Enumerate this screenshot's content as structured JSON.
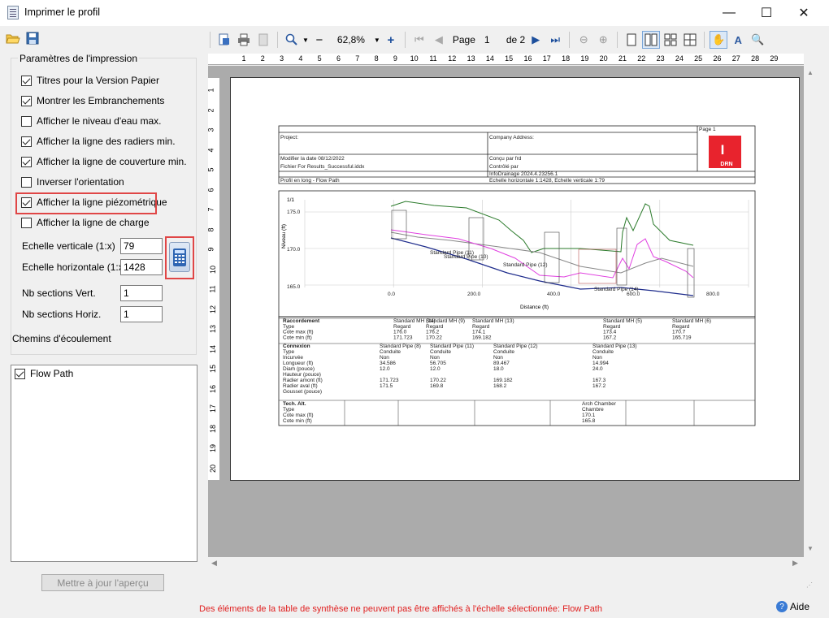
{
  "window": {
    "title": "Imprimer le profil",
    "minimize": "—",
    "maximize": "☐",
    "close": "✕"
  },
  "left_toolbar": {
    "open_icon": "folder-open-icon",
    "save_icon": "save-icon"
  },
  "print_settings": {
    "group_title": "Paramètres de l'impression",
    "options": [
      {
        "label": "Titres pour la Version Papier",
        "checked": true
      },
      {
        "label": "Montrer les Embranchements",
        "checked": true
      },
      {
        "label": "Afficher le niveau d'eau max.",
        "checked": false
      },
      {
        "label": "Afficher la ligne des radiers min.",
        "checked": true
      },
      {
        "label": "Afficher la ligne de couverture min.",
        "checked": true
      },
      {
        "label": "Inverser l'orientation",
        "checked": false
      },
      {
        "label": "Afficher la ligne piézométrique",
        "checked": true
      },
      {
        "label": "Afficher la ligne de charge",
        "checked": false
      }
    ],
    "vertical_scale_label": "Echelle verticale (1:x)",
    "vertical_scale_value": "79",
    "horizontal_scale_label": "Echelle horizontale (1:x)",
    "horizontal_scale_value": "1428",
    "vert_sections_label": "Nb sections Vert.",
    "vert_sections_value": "1",
    "horiz_sections_label": "Nb sections Horiz.",
    "horiz_sections_value": "1",
    "flow_paths_label": "Chemins d'écoulement"
  },
  "flow_paths": [
    {
      "label": "Flow Path",
      "checked": true
    }
  ],
  "update_button": "Mettre à jour l'aperçu",
  "preview_toolbar": {
    "zoom_value": "62,8%",
    "page_label": "Page",
    "page_current": "1",
    "page_of": "de 2",
    "minus": "−",
    "plus": "+"
  },
  "ruler_h": [
    "1",
    "2",
    "3",
    "4",
    "5",
    "6",
    "7",
    "8",
    "9",
    "10",
    "11",
    "12",
    "13",
    "14",
    "15",
    "16",
    "17",
    "18",
    "19",
    "20",
    "21",
    "22",
    "23",
    "24",
    "25",
    "26",
    "27",
    "28",
    "29"
  ],
  "ruler_v": [
    "1",
    "2",
    "3",
    "4",
    "5",
    "6",
    "7",
    "8",
    "9",
    "10",
    "11",
    "12",
    "13",
    "14",
    "15",
    "16",
    "17",
    "18",
    "19",
    "20"
  ],
  "report": {
    "project_label": "Project:",
    "company_label": "Company Address:",
    "page_label": "Page 1",
    "modified": "Modifier la date 08/12/2022",
    "file": "Fichier For Results_Successful.iddx",
    "designed": "Conçu par frd",
    "checked": "Contrôlé par",
    "version": "InfoDrainage 2024.4.23256.1",
    "profile": "Profil en long - Flow Path",
    "scales": "Echelle horizontale 1:1428, Echelle verticale 1:79",
    "logo_letter": "I",
    "logo_text": "DRN",
    "chart_scale": "1/1",
    "y_axis": "Niveau (ft)",
    "x_axis": "Distance (ft)",
    "y_ticks": [
      "175.0",
      "170.0",
      "165.0"
    ],
    "x_ticks": [
      "0.0",
      "200.0",
      "400.0",
      "600.0",
      "800.0"
    ],
    "pipe_labels": [
      "Standard Pipe (11)",
      "Standard Pipe (10)",
      "Standard Pipe (12)",
      "Standard Pipe (14)"
    ],
    "table_rows_a": [
      "Raccordement",
      "Type",
      "Cote max (ft)",
      "Cote min (ft)"
    ],
    "table_a": [
      [
        "Standard MH (14)",
        "Regard",
        "176.0",
        "171.723"
      ],
      [
        "Standard MH (9)",
        "Regard",
        "176.2",
        "170.22"
      ],
      [
        "Standard MH (13)",
        "Regard",
        "174.1",
        "169.182"
      ],
      [
        "Standard MH (5)",
        "Regard",
        "173.4",
        "167.2"
      ],
      [
        "Standard MH (6)",
        "Regard",
        "170.7",
        "165.719"
      ]
    ],
    "table_rows_b": [
      "Connexion",
      "Type",
      "Incurvée",
      "Longueur (ft)",
      "Diam (pouce)",
      "Hauteur (pouce)",
      "Radier amont (ft)",
      "Radier aval (ft)",
      "Gousset (pouce)"
    ],
    "table_b": [
      [
        "Standard Pipe (8)",
        "Conduite",
        "Non",
        "34.586",
        "12.0",
        "",
        "171.723",
        "171.5"
      ],
      [
        "Standard Pipe (11)",
        "Conduite",
        "Non",
        "56.705",
        "12.0",
        "",
        "170.22",
        "169.8"
      ],
      [
        "Standard Pipe (12)",
        "Conduite",
        "Non",
        "89.467",
        "18.0",
        "",
        "169.182",
        "168.2"
      ],
      [
        "Standard Pipe (13)",
        "Conduite",
        "Non",
        "14.994",
        "24.0",
        "",
        "167.3",
        "167.2"
      ]
    ],
    "table_rows_c": [
      "Tech. Alt.",
      "Type",
      "Cote max (ft)",
      "Cote min (ft)"
    ],
    "table_c": [
      "Arch Chamber",
      "Chambre",
      "170.1",
      "165.8"
    ]
  },
  "status": {
    "error": "Des éléments de la table de synthèse ne peuvent pas être affichés à l'échelle sélectionnée: Flow Path",
    "help": "Aide"
  }
}
